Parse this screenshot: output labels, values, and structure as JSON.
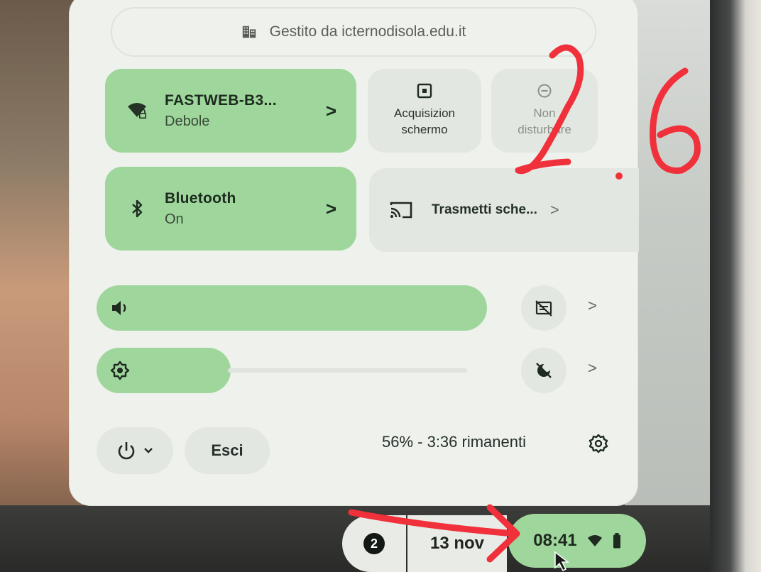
{
  "managed": {
    "icon": "building-icon",
    "text": "Gestito da icternodisola.edu.it"
  },
  "wifi": {
    "icon": "wifi-lock-icon",
    "name": "FASTWEB-B3...",
    "status": "Debole",
    "chevron": ">",
    "state": "on"
  },
  "bluetooth": {
    "icon": "bluetooth-icon",
    "name": "Bluetooth",
    "status": "On",
    "chevron": ">",
    "state": "on"
  },
  "screen_capture": {
    "icon": "screen-capture-icon",
    "line1": "Acquisizion",
    "line2": "schermo"
  },
  "dnd": {
    "icon": "do-not-disturb-icon",
    "line1": "Non",
    "line2": "disturbare"
  },
  "cast": {
    "icon": "cast-icon",
    "label": "Trasmetti sche...",
    "chevron": ">"
  },
  "volume": {
    "icon": "volume-icon",
    "level": 1.0,
    "side_icon": "audio-settings-icon",
    "chevron": ">"
  },
  "brightness": {
    "icon": "brightness-icon",
    "level": 0.5,
    "side_icon": "night-light-off-icon",
    "chevron": ">"
  },
  "footer": {
    "power_icon": "power-icon",
    "power_chevron": "chevron-down-icon",
    "signout_label": "Esci",
    "battery_text": "56% - 3:36 rimanenti",
    "settings_icon": "gear-icon"
  },
  "shelf": {
    "notification_count": "2",
    "date": "13 nov",
    "time": "08:41",
    "wifi_icon": "wifi-icon",
    "battery_icon": "battery-icon"
  },
  "colors": {
    "accent": "#9fd69c",
    "panel": "#eef1ec",
    "tile_off": "#e3e7e1",
    "annotation": "#f0303a"
  }
}
